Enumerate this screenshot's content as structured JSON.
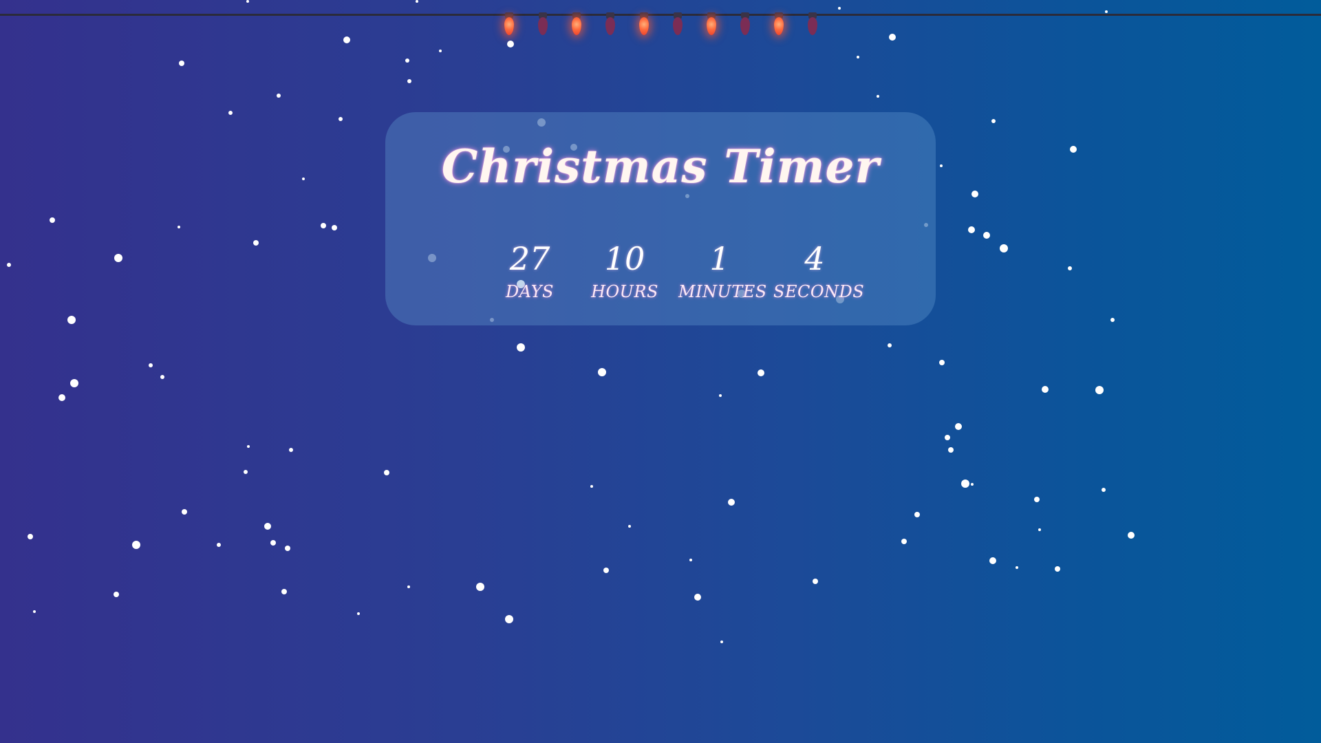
{
  "title": "Christmas Timer",
  "countdown": [
    {
      "value": "27",
      "label": "Days"
    },
    {
      "value": "10",
      "label": "Hours"
    },
    {
      "value": "1",
      "label": "Minutes"
    },
    {
      "value": "4",
      "label": "Seconds"
    }
  ],
  "lights": [
    {
      "state": "on"
    },
    {
      "state": "off"
    },
    {
      "state": "on"
    },
    {
      "state": "off"
    },
    {
      "state": "on"
    },
    {
      "state": "off"
    },
    {
      "state": "on"
    },
    {
      "state": "off"
    },
    {
      "state": "on"
    },
    {
      "state": "off"
    }
  ],
  "colors": {
    "bulb_on": "#ff5a32",
    "bulb_off": "#7b2d55",
    "title_glow": "#ff96e6"
  }
}
